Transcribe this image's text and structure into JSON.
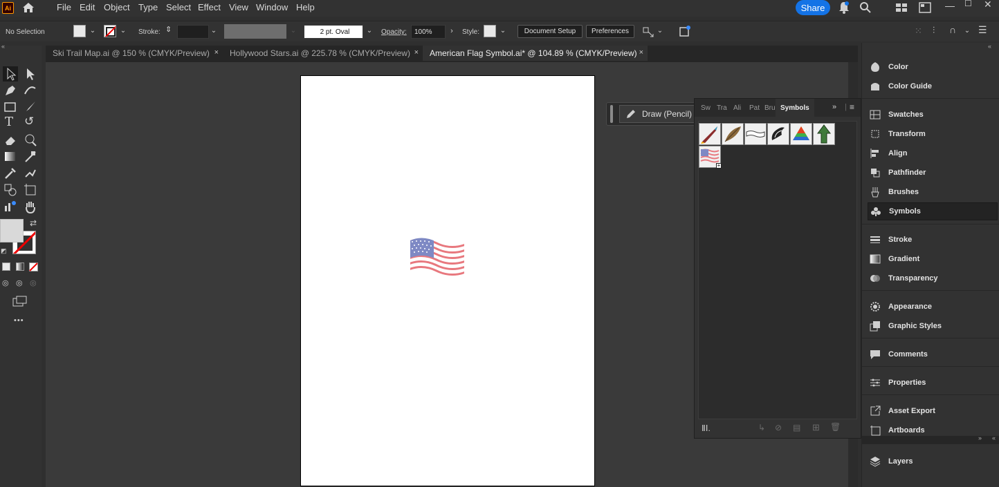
{
  "app": {
    "logo": "Ai"
  },
  "menu": [
    "File",
    "Edit",
    "Object",
    "Type",
    "Select",
    "Effect",
    "View",
    "Window",
    "Help"
  ],
  "share_label": "Share",
  "control": {
    "selection": "No Selection",
    "stroke_label": "Stroke:",
    "brush_value": "2 pt. Oval",
    "opacity_label": "Opacity:",
    "opacity_value": "100%",
    "style_label": "Style:",
    "document_setup": "Document Setup",
    "preferences": "Preferences"
  },
  "tabs": [
    {
      "label": "Ski Trail Map.ai @ 150 % (CMYK/Preview)",
      "close": "×"
    },
    {
      "label": "Hollywood Stars.ai @ 225.78 % (CMYK/Preview)",
      "close": "×"
    },
    {
      "label": "American Flag Symbol.ai* @ 104.89 % (CMYK/Preview)",
      "close": "×"
    }
  ],
  "draw_mode": "Draw (Pencil)",
  "toolbar_more": "•••",
  "symbols_panel": {
    "tabs": [
      "Sw",
      "Tra",
      "Ali",
      "Pat",
      "Bru",
      "Symbols"
    ],
    "active_tab": "Symbols",
    "symbols": [
      "rocket-symbol",
      "feather-symbol",
      "banner-symbol",
      "ornament-symbol",
      "pyramid-symbol",
      "arrow-up-symbol",
      "american-flag-symbol"
    ]
  },
  "right_panel": [
    {
      "label": "Color",
      "icon": "color-icon"
    },
    {
      "label": "Color Guide",
      "icon": "color-guide-icon"
    },
    {
      "label": "Swatches",
      "icon": "swatches-icon"
    },
    {
      "label": "Transform",
      "icon": "transform-icon"
    },
    {
      "label": "Align",
      "icon": "align-icon"
    },
    {
      "label": "Pathfinder",
      "icon": "pathfinder-icon"
    },
    {
      "label": "Brushes",
      "icon": "brushes-icon"
    },
    {
      "label": "Symbols",
      "icon": "symbols-icon"
    },
    {
      "label": "Stroke",
      "icon": "stroke-icon"
    },
    {
      "label": "Gradient",
      "icon": "gradient-icon"
    },
    {
      "label": "Transparency",
      "icon": "transparency-icon"
    },
    {
      "label": "Appearance",
      "icon": "appearance-icon"
    },
    {
      "label": "Graphic Styles",
      "icon": "graphic-styles-icon"
    },
    {
      "label": "Comments",
      "icon": "comments-icon"
    },
    {
      "label": "Properties",
      "icon": "properties-icon"
    },
    {
      "label": "Asset Export",
      "icon": "asset-export-icon"
    },
    {
      "label": "Artboards",
      "icon": "artboards-icon"
    },
    {
      "label": "Layers",
      "icon": "layers-icon"
    }
  ],
  "colors": {
    "accent": "#1473e6",
    "logo": "#ff9a00",
    "flag_red": "#e8787e",
    "flag_blue": "#7e89c4"
  }
}
